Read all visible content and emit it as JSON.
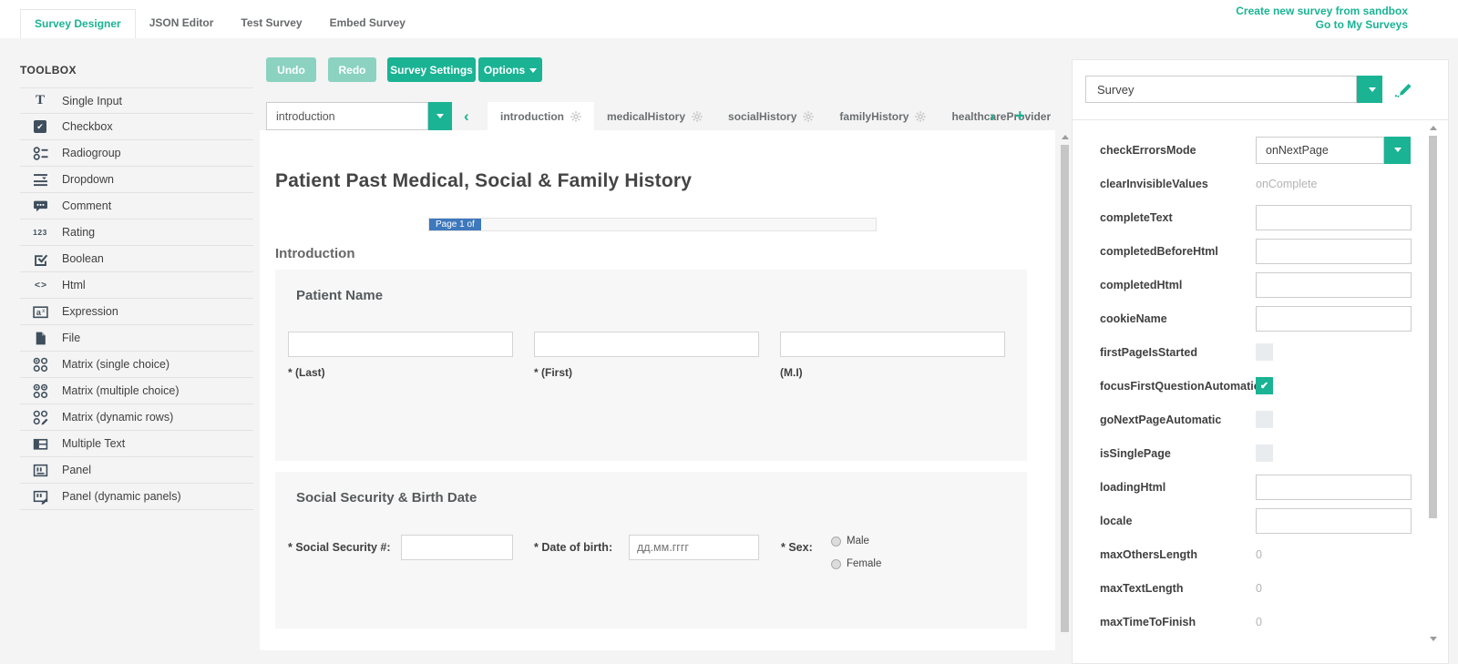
{
  "colors": {
    "accent": "#1ab394",
    "accent_light": "#8bd2c1",
    "badge_blue": "#3e78bd",
    "icon_dark": "#3f4e5c"
  },
  "header": {
    "tabs": [
      {
        "label": "Survey Designer",
        "active": true
      },
      {
        "label": "JSON Editor",
        "active": false
      },
      {
        "label": "Test Survey",
        "active": false
      },
      {
        "label": "Embed Survey",
        "active": false
      }
    ],
    "links": [
      "Create new survey from sandbox",
      "Go to My Surveys"
    ]
  },
  "toolbox": {
    "title": "TOOLBOX",
    "items": [
      {
        "label": "Single Input",
        "icon": "single-input-icon"
      },
      {
        "label": "Checkbox",
        "icon": "checkbox-icon"
      },
      {
        "label": "Radiogroup",
        "icon": "radiogroup-icon"
      },
      {
        "label": "Dropdown",
        "icon": "dropdown-icon"
      },
      {
        "label": "Comment",
        "icon": "comment-icon"
      },
      {
        "label": "Rating",
        "icon": "rating-icon"
      },
      {
        "label": "Boolean",
        "icon": "boolean-icon"
      },
      {
        "label": "Html",
        "icon": "html-icon"
      },
      {
        "label": "Expression",
        "icon": "expression-icon"
      },
      {
        "label": "File",
        "icon": "file-icon"
      },
      {
        "label": "Matrix (single choice)",
        "icon": "matrix-single-icon"
      },
      {
        "label": "Matrix (multiple choice)",
        "icon": "matrix-multiple-icon"
      },
      {
        "label": "Matrix (dynamic rows)",
        "icon": "matrix-dynamic-icon"
      },
      {
        "label": "Multiple Text",
        "icon": "multiple-text-icon"
      },
      {
        "label": "Panel",
        "icon": "panel-icon"
      },
      {
        "label": "Panel (dynamic panels)",
        "icon": "panel-dynamic-icon"
      }
    ]
  },
  "toolbar": {
    "undo": "Undo",
    "redo": "Redo",
    "settings": "Survey Settings",
    "options": "Options"
  },
  "page_nav": {
    "selected_page": "introduction",
    "tabs": [
      {
        "label": "introduction",
        "active": true,
        "gear": true
      },
      {
        "label": "medicalHistory",
        "active": false,
        "gear": true
      },
      {
        "label": "socialHistory",
        "active": false,
        "gear": true
      },
      {
        "label": "familyHistory",
        "active": false,
        "gear": true
      },
      {
        "label": "healthcareProvider",
        "active": false,
        "gear": false
      }
    ]
  },
  "survey": {
    "title": "Patient Past Medical, Social & Family History",
    "progress_label": "Page 1 of",
    "page_title": "Introduction",
    "panels": [
      {
        "title": "Patient Name",
        "questions": [
          {
            "value": "",
            "label": "* (Last)"
          },
          {
            "value": "",
            "label": "* (First)"
          },
          {
            "value": "",
            "label": "(M.I)"
          }
        ]
      },
      {
        "title": "Social Security & Birth Date",
        "ssn_label": "* Social Security #:",
        "ssn_value": "",
        "dob_label": "* Date of birth:",
        "dob_placeholder": "дд.мм.гггг",
        "sex_label": "* Sex:",
        "sex_options": [
          "Male",
          "Female"
        ]
      }
    ]
  },
  "properties": {
    "object_selector": "Survey",
    "rows": [
      {
        "name": "checkErrorsMode",
        "type": "dropdown",
        "value": "onNextPage"
      },
      {
        "name": "clearInvisibleValues",
        "type": "readonly",
        "value": "onComplete"
      },
      {
        "name": "completeText",
        "type": "text",
        "value": ""
      },
      {
        "name": "completedBeforeHtml",
        "type": "text",
        "value": ""
      },
      {
        "name": "completedHtml",
        "type": "text",
        "value": ""
      },
      {
        "name": "cookieName",
        "type": "text",
        "value": ""
      },
      {
        "name": "firstPageIsStarted",
        "type": "checkbox",
        "checked": false
      },
      {
        "name": "focusFirstQuestionAutomatic",
        "type": "checkbox",
        "checked": true
      },
      {
        "name": "goNextPageAutomatic",
        "type": "checkbox",
        "checked": false
      },
      {
        "name": "isSinglePage",
        "type": "checkbox",
        "checked": false
      },
      {
        "name": "loadingHtml",
        "type": "text",
        "value": ""
      },
      {
        "name": "locale",
        "type": "text",
        "value": ""
      },
      {
        "name": "maxOthersLength",
        "type": "readonly",
        "value": "0"
      },
      {
        "name": "maxTextLength",
        "type": "readonly",
        "value": "0"
      },
      {
        "name": "maxTimeToFinish",
        "type": "readonly",
        "value": "0"
      }
    ]
  }
}
